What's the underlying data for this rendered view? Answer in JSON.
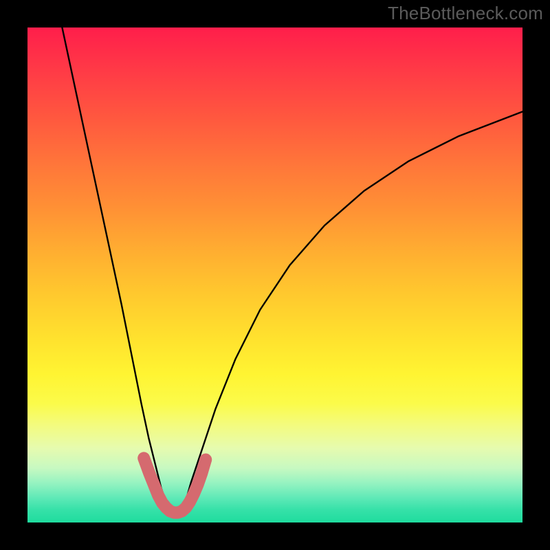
{
  "watermark": "TheBottleneck.com",
  "chart_data": {
    "type": "line",
    "title": "",
    "xlabel": "",
    "ylabel": "",
    "xlim": [
      0,
      100
    ],
    "ylim": [
      0,
      100
    ],
    "grid": false,
    "legend": false,
    "annotations": [],
    "series": [
      {
        "name": "bottleneck-curve",
        "color": "#000000",
        "x": [
          7,
          10,
          13,
          16,
          19,
          21,
          23,
          24.5,
          26,
          27,
          28,
          29,
          30,
          31,
          32,
          33,
          35,
          38,
          42,
          47,
          53,
          60,
          68,
          77,
          87,
          100
        ],
        "y": [
          100,
          86,
          72,
          58,
          44,
          34,
          24,
          17,
          11,
          7,
          4,
          2.5,
          2,
          2.5,
          4.5,
          8,
          14,
          23,
          33,
          43,
          52,
          60,
          67,
          73,
          78,
          83
        ]
      },
      {
        "name": "highlight-band",
        "color": "#d56a6f",
        "x": [
          23.5,
          24.6,
          25.6,
          26.4,
          27.2,
          28,
          28.8,
          29.6,
          30.4,
          31.2,
          32,
          32.8,
          33.6,
          34.4,
          35.2,
          36
        ],
        "y": [
          13,
          10,
          7.5,
          5.5,
          4,
          3,
          2.3,
          2,
          2,
          2.3,
          3,
          4.2,
          5.8,
          7.7,
          10,
          12.7
        ]
      }
    ],
    "gradient_background": {
      "top_color": "#ff1e4b",
      "bottom_color": "#1fdc9e",
      "description": "vertical red-orange-yellow-green heatmap gradient"
    }
  }
}
